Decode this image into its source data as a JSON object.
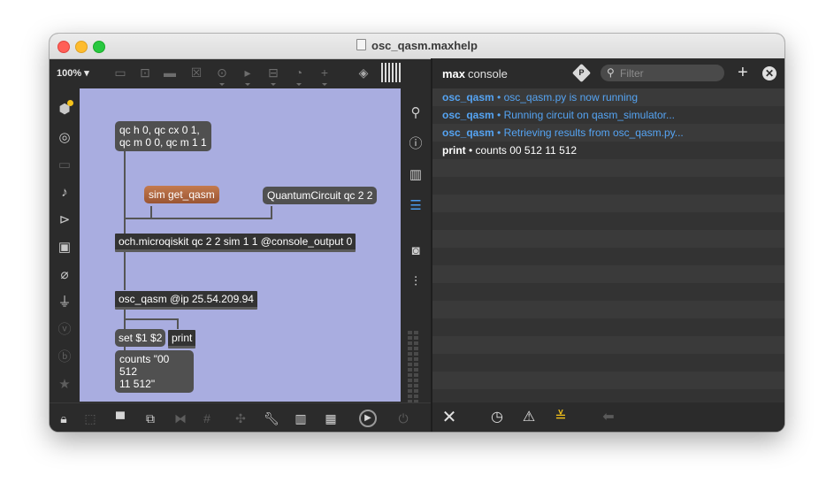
{
  "window": {
    "title": "osc_qasm.maxhelp",
    "buttons": [
      "close",
      "minimize",
      "zoom"
    ]
  },
  "patcher_toolbar": {
    "zoom": "100%",
    "icons": [
      "presentation-icon",
      "comment-icon",
      "message-icon",
      "button-icon",
      "toggle-icon",
      "number-icon",
      "slider-icon",
      "dial-icon",
      "plus-icon",
      "paint-bucket-icon",
      "grid-icon"
    ]
  },
  "left_sidebar": {
    "icons": [
      "packages-icon",
      "target-icon",
      "device-icon",
      "music-note-icon",
      "media-icon",
      "image-icon",
      "paperclip-icon",
      "plug-icon",
      "v-icon",
      "b-icon",
      "star-icon"
    ]
  },
  "patch": {
    "qc_message": [
      "qc h 0, qc cx 0 1,",
      "qc m 0 0, qc m 1 1"
    ],
    "sim_message": "sim get_qasm",
    "quantum_circuit_message": "QuantumCircuit qc 2 2",
    "microqiskit_object": "och.microqiskit qc 2 2 sim 1 1 @console_output 0",
    "osc_qasm_object": "osc_qasm @ip 25.54.209.94",
    "set_message": "set $1 $2",
    "print_object": "print",
    "counts_message": [
      "counts \"00 512",
      "11 512\""
    ]
  },
  "right_sidebar": {
    "icons": [
      "search-icon",
      "info-icon",
      "reference-icon",
      "list-icon",
      "snapshot-icon",
      "mixer-icon"
    ]
  },
  "patcher_bottom": {
    "icons": [
      "lock-icon",
      "edit-icon",
      "presentation-icon",
      "new-view-icon",
      "layout-icon",
      "snap-grid-icon",
      "debug-icon",
      "wrench-icon",
      "piano-icon",
      "keyboard-icon",
      "audio-icon",
      "power-icon"
    ]
  },
  "console": {
    "title_bold": "max",
    "title_rest": "console",
    "filter_placeholder": "Filter",
    "lines": [
      {
        "src": "osc_qasm",
        "sep": " • ",
        "msg": "osc_qasm.py is now running",
        "color": "blue"
      },
      {
        "src": "osc_qasm",
        "sep": " • ",
        "msg": "Running circuit on qasm_simulator...",
        "color": "blue"
      },
      {
        "src": "osc_qasm",
        "sep": " • ",
        "msg": "Retrieving results from osc_qasm.py...",
        "color": "blue"
      },
      {
        "src": "print",
        "sep": " • ",
        "msg": "counts 00 512 11 512",
        "color": "white"
      }
    ],
    "bottom_icons": [
      "clear-icon",
      "clock-icon",
      "warning-icon",
      "stack-icon",
      "back-arrow-icon"
    ]
  }
}
